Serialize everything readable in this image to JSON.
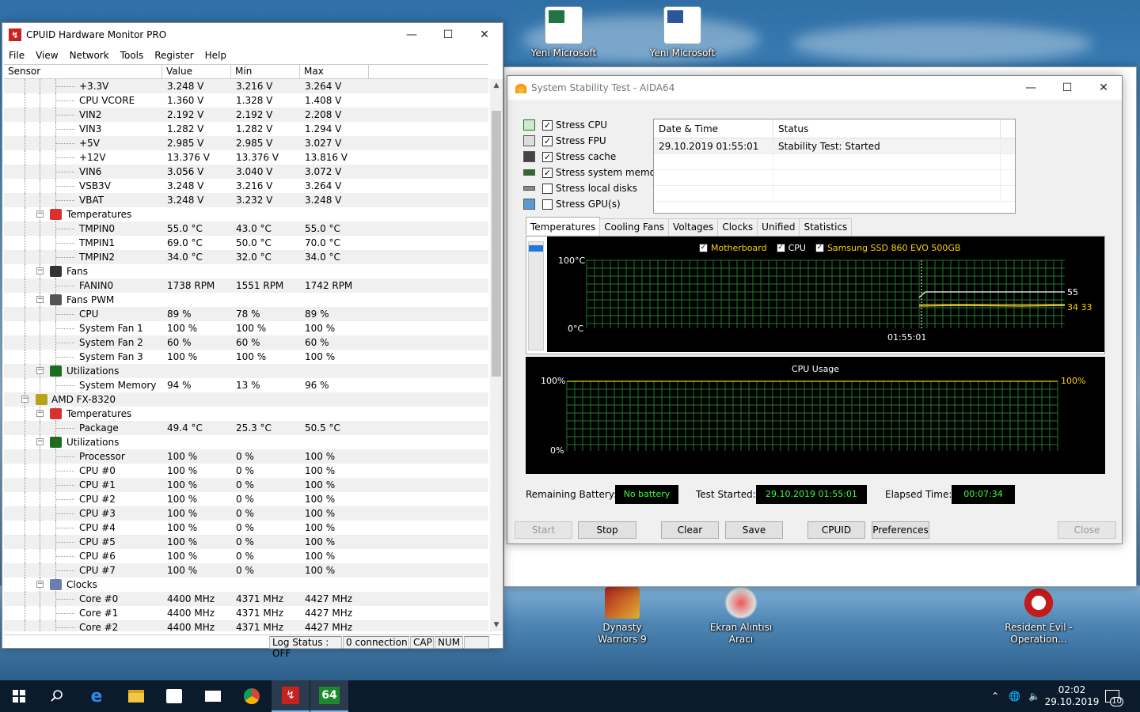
{
  "desktop": {
    "icons": [
      {
        "label": "Yeni Microsoft",
        "name": "desktop-icon-excel"
      },
      {
        "label": "Yeni Microsoft",
        "name": "desktop-icon-word"
      },
      {
        "label": "Dynasty Warriors 9",
        "name": "desktop-icon-dynasty-warriors"
      },
      {
        "label": "Ekran Alıntısı Aracı",
        "name": "desktop-icon-snipping-tool"
      },
      {
        "label": "Resident Evil - Operation...",
        "name": "desktop-icon-resident-evil"
      }
    ]
  },
  "hwmonitor": {
    "title": "CPUID Hardware Monitor PRO",
    "menu": [
      "File",
      "View",
      "Network",
      "Tools",
      "Register",
      "Help"
    ],
    "columns": [
      "Sensor",
      "Value",
      "Min",
      "Max"
    ],
    "rows": [
      {
        "level": 3,
        "name": "+3.3V",
        "value": "3.248 V",
        "min": "3.216 V",
        "max": "3.264 V"
      },
      {
        "level": 3,
        "name": "CPU VCORE",
        "value": "1.360 V",
        "min": "1.328 V",
        "max": "1.408 V"
      },
      {
        "level": 3,
        "name": "VIN2",
        "value": "2.192 V",
        "min": "2.192 V",
        "max": "2.208 V"
      },
      {
        "level": 3,
        "name": "VIN3",
        "value": "1.282 V",
        "min": "1.282 V",
        "max": "1.294 V"
      },
      {
        "level": 3,
        "name": "+5V",
        "value": "2.985 V",
        "min": "2.985 V",
        "max": "3.027 V"
      },
      {
        "level": 3,
        "name": "+12V",
        "value": "13.376 V",
        "min": "13.376 V",
        "max": "13.816 V"
      },
      {
        "level": 3,
        "name": "VIN6",
        "value": "3.056 V",
        "min": "3.040 V",
        "max": "3.072 V"
      },
      {
        "level": 3,
        "name": "VSB3V",
        "value": "3.248 V",
        "min": "3.216 V",
        "max": "3.264 V"
      },
      {
        "level": 3,
        "name": "VBAT",
        "value": "3.248 V",
        "min": "3.232 V",
        "max": "3.248 V"
      },
      {
        "level": 2,
        "name": "Temperatures",
        "group": true,
        "icon": "thermometer-icon",
        "color": "#d93030",
        "value": "",
        "min": "",
        "max": ""
      },
      {
        "level": 3,
        "name": "TMPIN0",
        "value": "55.0 °C",
        "min": "43.0 °C",
        "max": "55.0 °C"
      },
      {
        "level": 3,
        "name": "TMPIN1",
        "value": "69.0 °C",
        "min": "50.0 °C",
        "max": "70.0 °C"
      },
      {
        "level": 3,
        "name": "TMPIN2",
        "value": "34.0 °C",
        "min": "32.0 °C",
        "max": "34.0 °C"
      },
      {
        "level": 2,
        "name": "Fans",
        "group": true,
        "icon": "fan-icon",
        "color": "#333333",
        "value": "",
        "min": "",
        "max": ""
      },
      {
        "level": 3,
        "name": "FANIN0",
        "value": "1738 RPM",
        "min": "1551 RPM",
        "max": "1742 RPM"
      },
      {
        "level": 2,
        "name": "Fans PWM",
        "group": true,
        "icon": "fan-pwm-icon",
        "color": "#555555",
        "value": "",
        "min": "",
        "max": ""
      },
      {
        "level": 3,
        "name": "CPU",
        "value": "89 %",
        "min": "78 %",
        "max": "89 %"
      },
      {
        "level": 3,
        "name": "System Fan 1",
        "value": "100 %",
        "min": "100 %",
        "max": "100 %"
      },
      {
        "level": 3,
        "name": "System Fan 2",
        "value": "60 %",
        "min": "60 %",
        "max": "60 %"
      },
      {
        "level": 3,
        "name": "System Fan 3",
        "value": "100 %",
        "min": "100 %",
        "max": "100 %"
      },
      {
        "level": 2,
        "name": "Utilizations",
        "group": true,
        "icon": "utilization-icon",
        "color": "#1f6b1f",
        "value": "",
        "min": "",
        "max": ""
      },
      {
        "level": 3,
        "name": "System Memory",
        "value": "94 %",
        "min": "13 %",
        "max": "96 %"
      },
      {
        "level": 1,
        "name": "AMD FX-8320",
        "group": true,
        "icon": "cpu-chip-icon",
        "color": "#b8a21a",
        "value": "",
        "min": "",
        "max": ""
      },
      {
        "level": 2,
        "name": "Temperatures",
        "group": true,
        "icon": "thermometer-icon",
        "color": "#d93030",
        "value": "",
        "min": "",
        "max": ""
      },
      {
        "level": 3,
        "name": "Package",
        "value": "49.4 °C",
        "min": "25.3 °C",
        "max": "50.5 °C"
      },
      {
        "level": 2,
        "name": "Utilizations",
        "group": true,
        "icon": "utilization-icon",
        "color": "#1f6b1f",
        "value": "",
        "min": "",
        "max": ""
      },
      {
        "level": 3,
        "name": "Processor",
        "value": "100 %",
        "min": "0 %",
        "max": "100 %"
      },
      {
        "level": 3,
        "name": "CPU #0",
        "value": "100 %",
        "min": "0 %",
        "max": "100 %"
      },
      {
        "level": 3,
        "name": "CPU #1",
        "value": "100 %",
        "min": "0 %",
        "max": "100 %"
      },
      {
        "level": 3,
        "name": "CPU #2",
        "value": "100 %",
        "min": "0 %",
        "max": "100 %"
      },
      {
        "level": 3,
        "name": "CPU #3",
        "value": "100 %",
        "min": "0 %",
        "max": "100 %"
      },
      {
        "level": 3,
        "name": "CPU #4",
        "value": "100 %",
        "min": "0 %",
        "max": "100 %"
      },
      {
        "level": 3,
        "name": "CPU #5",
        "value": "100 %",
        "min": "0 %",
        "max": "100 %"
      },
      {
        "level": 3,
        "name": "CPU #6",
        "value": "100 %",
        "min": "0 %",
        "max": "100 %"
      },
      {
        "level": 3,
        "name": "CPU #7",
        "value": "100 %",
        "min": "0 %",
        "max": "100 %"
      },
      {
        "level": 2,
        "name": "Clocks",
        "group": true,
        "icon": "clock-icon",
        "color": "#6a7fb0",
        "value": "",
        "min": "",
        "max": ""
      },
      {
        "level": 3,
        "name": "Core #0",
        "value": "4400 MHz",
        "min": "4371 MHz",
        "max": "4427 MHz"
      },
      {
        "level": 3,
        "name": "Core #1",
        "value": "4400 MHz",
        "min": "4371 MHz",
        "max": "4427 MHz"
      },
      {
        "level": 3,
        "name": "Core #2",
        "value": "4400 MHz",
        "min": "4371 MHz",
        "max": "4427 MHz"
      }
    ],
    "status": {
      "log": "Log Status : OFF",
      "connection": "0 connection",
      "cap": "CAP",
      "num": "NUM"
    }
  },
  "aida": {
    "title": "System Stability Test - AIDA64",
    "stress_options": [
      {
        "label": "Stress CPU",
        "checked": true,
        "icon": "cpu-icon"
      },
      {
        "label": "Stress FPU",
        "checked": true,
        "icon": "fpu-icon"
      },
      {
        "label": "Stress cache",
        "checked": true,
        "icon": "cache-icon"
      },
      {
        "label": "Stress system memory",
        "checked": true,
        "icon": "memory-icon"
      },
      {
        "label": "Stress local disks",
        "checked": false,
        "icon": "disk-icon"
      },
      {
        "label": "Stress GPU(s)",
        "checked": false,
        "icon": "gpu-icon"
      }
    ],
    "status_table": {
      "headers": [
        "Date & Time",
        "Status"
      ],
      "rows": [
        [
          "29.10.2019 01:55:01",
          "Stability Test: Started"
        ]
      ]
    },
    "tabs": [
      "Temperatures",
      "Cooling Fans",
      "Voltages",
      "Clocks",
      "Unified",
      "Statistics"
    ],
    "active_tab": "Temperatures",
    "temp_graph": {
      "legend": [
        {
          "label": "Motherboard",
          "checked": true,
          "color": "#ffd000"
        },
        {
          "label": "CPU",
          "checked": true,
          "color": "#ffffff"
        },
        {
          "label": "Samsung SSD 860 EVO 500GB",
          "checked": true,
          "color": "#ffd000"
        }
      ],
      "y_top": "100°C",
      "y_bottom": "0°C",
      "x_time": "01:55:01",
      "readouts": [
        "55",
        "34 33"
      ]
    },
    "cpu_graph": {
      "title": "CPU Usage",
      "y_top": "100%",
      "y_bottom": "0%",
      "readout": "100%"
    },
    "info": {
      "battery_label": "Remaining Battery:",
      "battery_value": "No battery",
      "started_label": "Test Started:",
      "started_value": "29.10.2019 01:55:01",
      "elapsed_label": "Elapsed Time:",
      "elapsed_value": "00:07:34"
    },
    "buttons": {
      "start": "Start",
      "stop": "Stop",
      "clear": "Clear",
      "save": "Save",
      "cpuid": "CPUID",
      "preferences": "Preferences",
      "close": "Close"
    }
  },
  "taskbar": {
    "time": "02:02",
    "date": "29.10.2019",
    "notifications": "10",
    "app_64_label": "64"
  }
}
